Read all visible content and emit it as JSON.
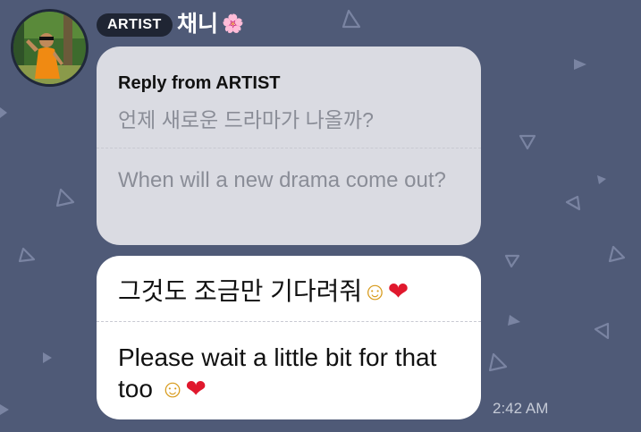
{
  "sender": {
    "badge": "ARTIST",
    "name": "채니",
    "name_emoji": "🌸"
  },
  "reply": {
    "header": "Reply from ARTIST",
    "question_korean": "언제 새로운 드라마가 나올까?",
    "question_english": "When will a new drama come out?"
  },
  "message": {
    "korean_text": "그것도 조금만 기다려줘",
    "english_text": "Please wait a little bit for that too",
    "emoji_smile": "☺",
    "emoji_heart": "❤",
    "time": "2:42 AM"
  },
  "colors": {
    "background": "#4f5a77",
    "reply_bubble": "#dadbe2",
    "message_bubble": "#ffffff",
    "badge": "#1f2533"
  }
}
